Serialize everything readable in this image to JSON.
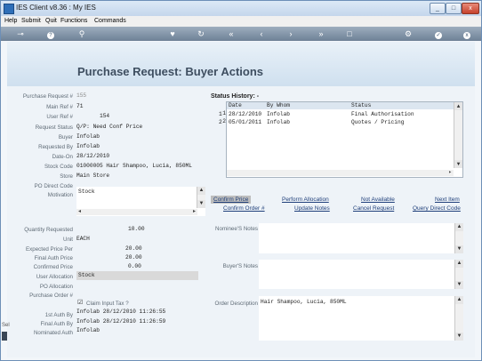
{
  "window": {
    "title": "IES Client v8.36 : My IES",
    "buttons": {
      "minimize": "_",
      "maximize": "□",
      "close": "x"
    }
  },
  "menu": [
    "Help",
    "Submit",
    "Quit",
    "Functions",
    "Commands"
  ],
  "toolbar": {
    "left": [
      {
        "icon": "key-icon",
        "glyph": "⊸"
      },
      {
        "icon": "help-icon",
        "glyph": "?"
      },
      {
        "icon": "search-icon",
        "glyph": "⚲"
      }
    ],
    "middle": [
      {
        "icon": "heart-icon",
        "glyph": "♥"
      },
      {
        "icon": "refresh-icon",
        "glyph": "↻"
      },
      {
        "icon": "rewind-icon",
        "glyph": "«"
      },
      {
        "icon": "back-icon",
        "glyph": "‹"
      },
      {
        "icon": "forward-icon",
        "glyph": "›"
      },
      {
        "icon": "fast-forward-icon",
        "glyph": "»"
      },
      {
        "icon": "new-record-icon",
        "glyph": "□"
      }
    ],
    "right": [
      {
        "icon": "settings-icon",
        "glyph": "⚙"
      },
      {
        "icon": "confirm-icon",
        "glyph": "✓"
      },
      {
        "icon": "exit-icon",
        "glyph": "x"
      }
    ]
  },
  "page": {
    "title": "Purchase Request: Buyer Actions"
  },
  "form": {
    "purchase_request_label": "Purchase Request #",
    "purchase_request": "155",
    "main_ref_label": "Main Ref #",
    "main_ref": "71",
    "user_ref_label": "User Ref #",
    "user_ref": "154",
    "request_status_label": "Request Status",
    "request_status": "Q/P: Need Conf Price",
    "buyer_label": "Buyer",
    "buyer": "Infolab",
    "requested_by_label": "Requested By",
    "requested_by": "Infolab",
    "date_on_label": "Date-On",
    "date_on": "28/12/2010",
    "stock_code_label": "Stock Code",
    "stock_code": "01000005 Hair Shampoo, Lucia, 850ML",
    "store_label": "Store",
    "store": "Main Store",
    "po_direct_code_label": "PO Direct Code",
    "po_direct_code": "",
    "motivation_label": "Motivation",
    "motivation": "Stock",
    "qty_requested_label": "Quantity Requested",
    "qty_requested": "10.00",
    "unit_label": "Unit",
    "unit": "EACH",
    "expected_price_label": "Expected Price Per",
    "expected_price": "20.00",
    "final_auth_price_label": "Final Auth Price",
    "final_auth_price": "20.00",
    "confirmed_price_label": "Confirmed Price",
    "confirmed_price": "0.00",
    "user_allocation_label": "User Allocation",
    "user_allocation": "Stock",
    "po_allocation_label": "PO Allocation",
    "po_allocation": "",
    "purchase_order_label": "Purchase Order #",
    "purchase_order": "",
    "claim_input_tax_label": "Claim Input Tax ?",
    "claim_input_tax_mark": "☑",
    "first_auth_label": "1st Auth By",
    "first_auth": "Infolab 28/12/2010 11:26:55",
    "final_auth_label": "Final Auth By",
    "final_auth": "Infolab 28/12/2010 11:26:59",
    "nominated_auth_label": "Nominated Auth",
    "nominated_auth": "Infolab"
  },
  "status_history": {
    "title": "Status History: -",
    "columns": [
      "Date",
      "By Whom",
      "Status"
    ],
    "rows": [
      {
        "n": "1",
        "date": "28/12/2010",
        "by": "Infolab",
        "status": "Final Authorisation"
      },
      {
        "n": "2",
        "date": "05/01/2011",
        "by": "Infolab",
        "status": "Quotes / Pricing"
      }
    ]
  },
  "actions": {
    "confirm_price": "Confirm Price",
    "perform_allocation": "Perform Allocation",
    "not_available": "Not Available",
    "next_item": "Next Item",
    "confirm_order": "Confirm Order #",
    "update_notes": "Update Notes",
    "cancel_request": "Cancel Request",
    "query_direct_code": "Query Direct Code"
  },
  "notes": {
    "nominees_label": "Nominee'S Notes",
    "nominees": "",
    "buyers_label": "Buyer'S Notes",
    "buyers": "",
    "order_desc_label": "Order Description",
    "order_desc": "Hair Shampoo, Lucia, 850ML"
  },
  "sidebar_fragment": {
    "text": "Sel"
  }
}
